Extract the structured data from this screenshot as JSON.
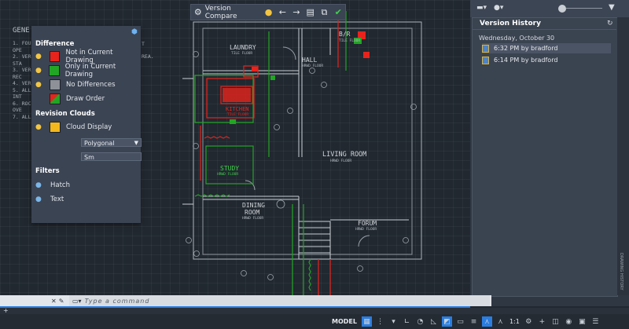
{
  "toolbar": {
    "title": "Version Compare",
    "icons": [
      "gear-icon",
      "lightbulb-icon",
      "arrow-left-icon",
      "arrow-right-icon",
      "paste-icon",
      "compare-icon",
      "checkmark-icon"
    ]
  },
  "notes": {
    "heading": "GENE",
    "lines": [
      "1. FOU",
      "OPE",
      "2. VER",
      "STA",
      "3. VER",
      "REC",
      "4. VER",
      "5. ALL",
      "INT",
      "6. ROC",
      "OVE",
      "7. ALL"
    ],
    "tails": [
      "T",
      "REA."
    ]
  },
  "diff_panel": {
    "difference_heading": "Difference",
    "items": [
      {
        "label": "Not in Current Drawing",
        "color": "#e8231c"
      },
      {
        "label": "Only in Current Drawing",
        "color": "#22a524"
      },
      {
        "label": "No Differences",
        "color": "#8e9197"
      },
      {
        "label": "Draw Order",
        "color": "#3b9a3b"
      }
    ],
    "revision_heading": "Revision Clouds",
    "cloud_display": {
      "label": "Cloud Display",
      "color": "#f4b81c"
    },
    "shape_select": "Polygonal",
    "size_field": "Sm",
    "filters_heading": "Filters",
    "filters": [
      {
        "label": "Hatch"
      },
      {
        "label": "Text"
      }
    ]
  },
  "plan_labels": {
    "laundry": "LAUNDRY",
    "laundry_floor": "TILE FLOOR",
    "br": "B/R",
    "br_floor": "TILE FLOOR",
    "hall": "HALL",
    "hall_floor": "HRWD FLOOR",
    "kitchen": "KITCHEN",
    "kitchen_floor": "TILE FLOOR",
    "living": "LIVING ROOM",
    "living_floor": "HRWD FLOOR",
    "study": "STUDY",
    "study_floor": "HRWD FLOOR",
    "dining": "DINING",
    "dining2": "ROOM",
    "dining_floor": "HRWD FLOOR",
    "forum": "FORUM",
    "forum_floor": "HRWD FLOOR"
  },
  "version_history": {
    "title": "Version History",
    "date": "Wednesday, October 30",
    "versions": [
      {
        "label": "6:32 PM by bradford",
        "selected": true
      },
      {
        "label": "6:14 PM by bradford",
        "selected": false
      }
    ],
    "side_tab": "DRAWING HISTORY"
  },
  "command": {
    "placeholder": "Type a command"
  },
  "status_bar": {
    "model": "MODEL",
    "scale": "1:1"
  },
  "colors": {
    "accent": "#2a7de1",
    "red": "#e8231c",
    "green": "#22a524"
  }
}
